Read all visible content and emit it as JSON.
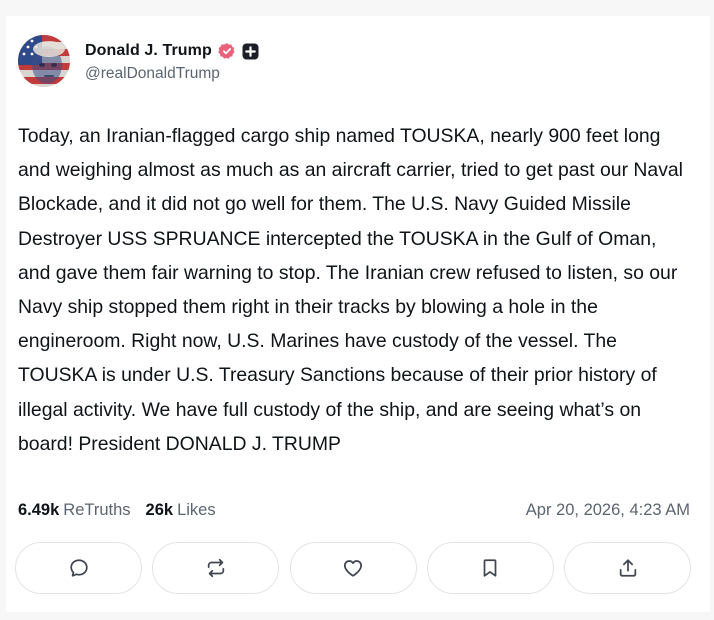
{
  "post": {
    "author": {
      "display_name": "Donald J. Trump",
      "handle": "@realDonaldTrump"
    },
    "text": "Today, an Iranian-flagged cargo ship named TOUSKA, nearly 900 feet long and weighing almost as much as an aircraft carrier, tried to get past our Naval Blockade, and it did not go well for them. The U.S. Navy Guided Missile Destroyer USS SPRUANCE intercepted the TOUSKA in the Gulf of Oman, and gave them fair warning to stop. The Iranian crew refused to listen, so our Navy ship stopped them right in their tracks by blowing a hole in the engineroom. Right now, U.S. Marines have custody of the vessel. The TOUSKA is under U.S. Treasury Sanctions because of their prior history of illegal activity. We have full custody of the ship, and are seeing what’s on board! President DONALD J. TRUMP",
    "stats": {
      "retruths_count": "6.49k",
      "retruths_label": "ReTruths",
      "likes_count": "26k",
      "likes_label": "Likes"
    },
    "timestamp": "Apr 20, 2026, 4:23 AM"
  },
  "icons": {
    "verified": "verified-badge-icon",
    "plus": "plus-badge-icon",
    "reply": "reply-icon",
    "retruth": "retruth-icon",
    "like": "heart-icon",
    "bookmark": "bookmark-icon",
    "share": "share-icon"
  },
  "colors": {
    "verified_badge": "#e9627a",
    "muted_text": "#5b6570",
    "icon": "#3f4650",
    "border": "#e3e4e8"
  }
}
